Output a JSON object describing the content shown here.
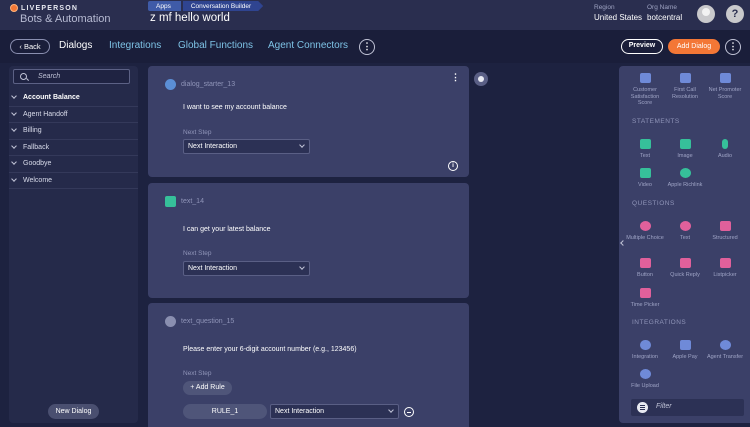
{
  "header": {
    "brand": "LIVEPERSON",
    "product": "Bots & Automation",
    "breadcrumbs": [
      "Apps",
      "Conversation Builder"
    ],
    "app_name": "z mf hello world",
    "region_label": "Region",
    "region_value": "United States",
    "org_label": "Org Name",
    "org_value": "botcentral",
    "help": "?"
  },
  "nav": {
    "back": "Back",
    "tabs": [
      "Dialogs",
      "Integrations",
      "Global Functions",
      "Agent Connectors"
    ],
    "more": "⋮",
    "preview": "Preview",
    "add_dialog": "Add Dialog"
  },
  "sidebar": {
    "search_placeholder": "Search",
    "dialogs": [
      "Account Balance",
      "Agent Handoff",
      "Billing",
      "Fallback",
      "Goodbye",
      "Welcome"
    ],
    "new_dialog": "New Dialog"
  },
  "canvas": {
    "cards": [
      {
        "title": "dialog_starter_13",
        "body": "I want to see my account balance",
        "next_step_label": "Next Step",
        "next_step_value": "Next Interaction"
      },
      {
        "title": "text_14",
        "body": "I can get your latest balance",
        "next_step_label": "Next Step",
        "next_step_value": "Next Interaction"
      },
      {
        "title": "text_question_15",
        "body": "Please enter your 6-digit account number (e.g., 123456)",
        "next_step_label": "Next Step",
        "add_rule": "+ Add Rule",
        "rule_name": "RULE_1",
        "rule_next": "Next Interaction"
      }
    ]
  },
  "palette": {
    "top": [
      "Customer Satisfaction Score",
      "First Call Resolution",
      "Net Promoter Score"
    ],
    "statements_header": "STATEMENTS",
    "statements": [
      "Text",
      "Image",
      "Audio",
      "Video",
      "Apple Richlink"
    ],
    "questions_header": "QUESTIONS",
    "questions": [
      "Multiple Choice",
      "Text",
      "Structured",
      "Button",
      "Quick Reply",
      "Listpicker",
      "Time Picker"
    ],
    "integrations_header": "INTEGRATIONS",
    "integrations": [
      "Integration",
      "Apple Pay",
      "Agent Transfer",
      "File Upload"
    ],
    "filter_placeholder": "Filter"
  },
  "colors": {
    "accent": "#f37736",
    "background": "#1d2240",
    "card": "#3b4068",
    "link": "#7ec3e6"
  }
}
